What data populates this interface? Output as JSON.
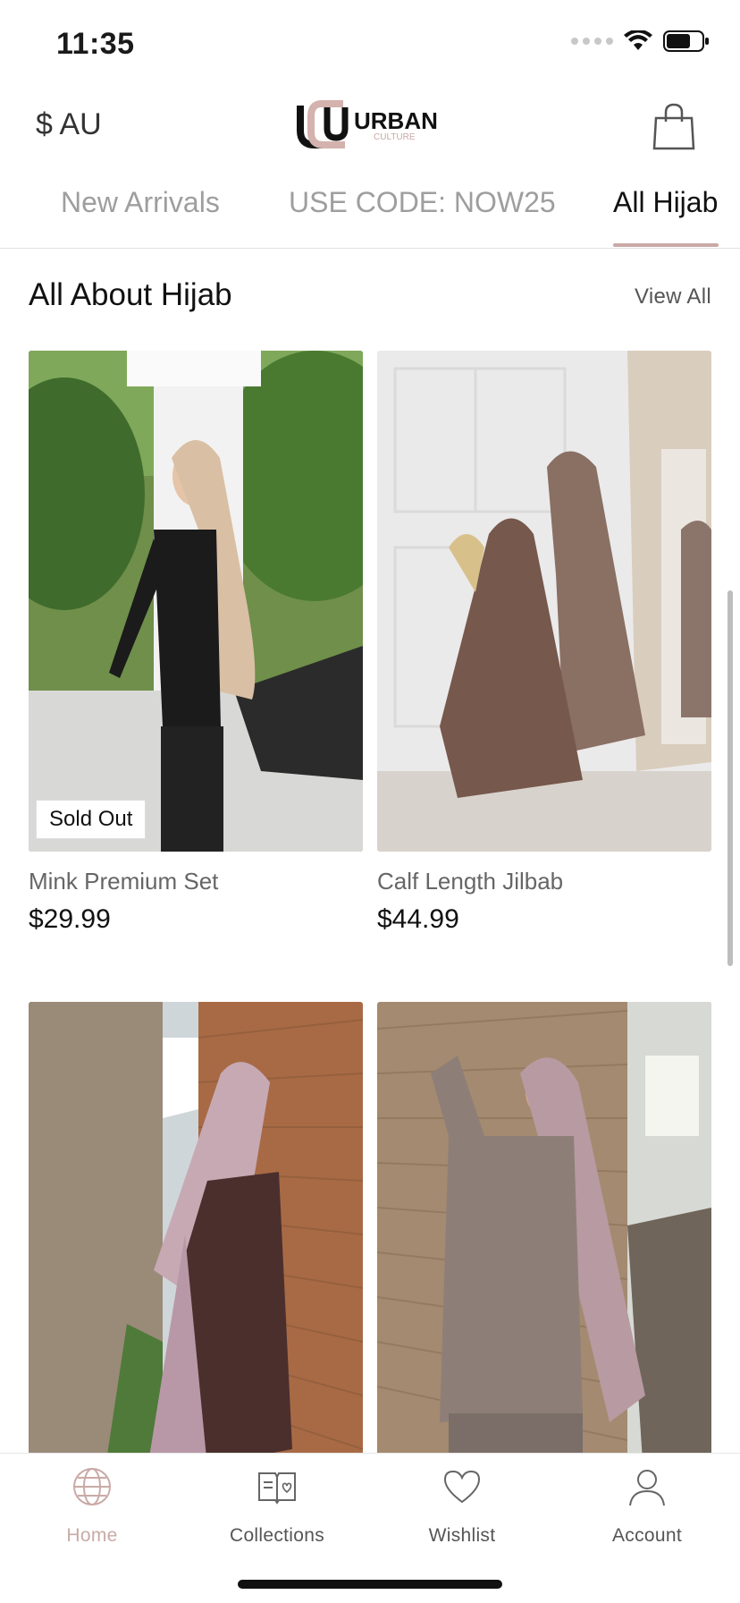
{
  "status_bar": {
    "time": "11:35"
  },
  "header": {
    "currency": "$ AU",
    "logo_text_main": "URBAN",
    "logo_text_sub": "CULTURE"
  },
  "tabs": [
    {
      "label": "New Arrivals",
      "active": false
    },
    {
      "label": "USE CODE: NOW25",
      "active": false
    },
    {
      "label": "All Hijab",
      "active": true
    }
  ],
  "section": {
    "title": "All About Hijab",
    "view_all": "View All"
  },
  "products": [
    {
      "name": "Mink Premium Set",
      "price": "$29.99",
      "badge": "Sold Out"
    },
    {
      "name": "Calf Length Jilbab",
      "price": "$44.99",
      "badge": ""
    },
    {
      "name": "",
      "price": "",
      "badge": ""
    },
    {
      "name": "",
      "price": "",
      "badge": ""
    }
  ],
  "bottom_nav": [
    {
      "label": "Home",
      "icon": "globe-icon",
      "active": true
    },
    {
      "label": "Collections",
      "icon": "book-icon",
      "active": false
    },
    {
      "label": "Wishlist",
      "icon": "heart-icon",
      "active": false
    },
    {
      "label": "Account",
      "icon": "user-icon",
      "active": false
    }
  ],
  "colors": {
    "accent": "#c9a8a6",
    "active_nav": "#c9aaa6",
    "muted_text": "#9e9e9e"
  }
}
